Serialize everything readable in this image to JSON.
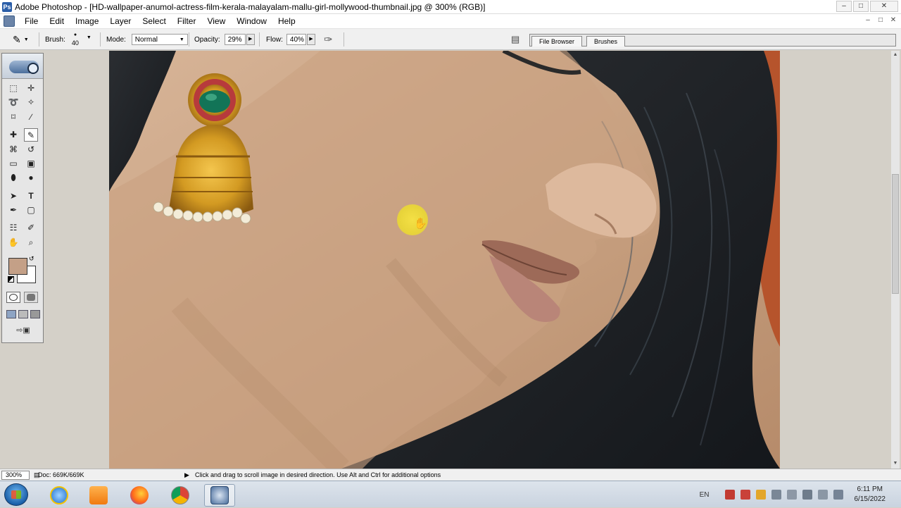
{
  "window": {
    "title": "Adobe Photoshop - [HD-wallpaper-anumol-actress-film-kerala-malayalam-mallu-girl-mollywood-thumbnail.jpg @ 300% (RGB)]",
    "minimize": "–",
    "maximize": "□",
    "close": "✕"
  },
  "menu": [
    "File",
    "Edit",
    "Image",
    "Layer",
    "Select",
    "Filter",
    "View",
    "Window",
    "Help"
  ],
  "options": {
    "brush_label": "Brush:",
    "brush_size": "40",
    "mode_label": "Mode:",
    "mode_value": "Normal",
    "opacity_label": "Opacity:",
    "opacity_value": "29%",
    "flow_label": "Flow:",
    "flow_value": "40%"
  },
  "palette_tabs": [
    "File Browser",
    "Brushes"
  ],
  "tools": [
    {
      "name": "marquee-tool",
      "glyph": "⬚"
    },
    {
      "name": "move-tool",
      "glyph": "✛"
    },
    {
      "name": "lasso-tool",
      "glyph": "➰"
    },
    {
      "name": "magic-wand-tool",
      "glyph": "✧"
    },
    {
      "name": "crop-tool",
      "glyph": "⌑"
    },
    {
      "name": "slice-tool",
      "glyph": "∕"
    },
    {
      "name": "healing-brush-tool",
      "glyph": "✚"
    },
    {
      "name": "brush-tool",
      "glyph": "✎"
    },
    {
      "name": "clone-stamp-tool",
      "glyph": "⌘"
    },
    {
      "name": "history-brush-tool",
      "glyph": "↺"
    },
    {
      "name": "eraser-tool",
      "glyph": "▭"
    },
    {
      "name": "gradient-tool",
      "glyph": "▣"
    },
    {
      "name": "blur-tool",
      "glyph": "⬮"
    },
    {
      "name": "dodge-tool",
      "glyph": "●"
    },
    {
      "name": "path-selection-tool",
      "glyph": "➤"
    },
    {
      "name": "type-tool",
      "glyph": "T"
    },
    {
      "name": "pen-tool",
      "glyph": "✒"
    },
    {
      "name": "shape-tool",
      "glyph": "▢"
    },
    {
      "name": "notes-tool",
      "glyph": "☷"
    },
    {
      "name": "eyedropper-tool",
      "glyph": "✐"
    },
    {
      "name": "hand-tool",
      "glyph": "✋"
    },
    {
      "name": "zoom-tool",
      "glyph": "⌕"
    }
  ],
  "status": {
    "zoom": "300%",
    "doc": "Doc: 669K/669K",
    "hint": "Click and drag to scroll image in desired direction.  Use Alt and Ctrl for additional options"
  },
  "taskbar": {
    "lang": "EN",
    "time": "6:11 PM",
    "date": "6/15/2022"
  },
  "colors": {
    "foreground": "#c4a087",
    "background": "#ffffff"
  }
}
